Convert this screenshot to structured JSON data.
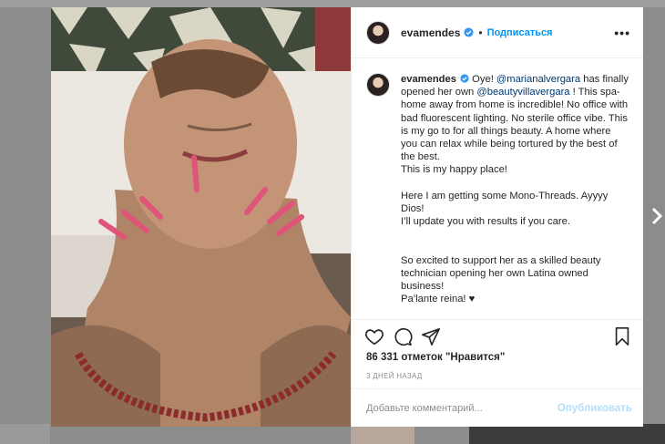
{
  "post": {
    "username": "evamendes",
    "follow_label": "Подписаться",
    "separator": "•",
    "more_label": "•••",
    "caption_user": "evamendes",
    "caption_parts": [
      {
        "text": "Oye! ",
        "type": "text"
      },
      {
        "text": "@marianalvergara",
        "type": "link"
      },
      {
        "text": " has finally opened her own ",
        "type": "text"
      },
      {
        "text": "@beautyvillavergara",
        "type": "link"
      },
      {
        "text": " ! This spa-home away from home is incredible! No office with bad fluorescent lighting. No sterile office vibe. This is my go to for all things beauty. A home where you can relax while being tortured by the best of the best.\nThis is my happy place!\n\nHere I am getting some Mono-Threads. Ayyyy Dios!\nI’ll update you with results if you care.\n\n\nSo excited to support her as a skilled beauty technician opening her own Latina owned business!\nPa’lante reina! ♥",
        "type": "text"
      }
    ],
    "likes": "86 331 отметок \"Нравится\"",
    "date": "3 ДНЕЙ НАЗАД",
    "comment_placeholder": "Добавьте комментарий...",
    "publish_label": "Опубликовать"
  },
  "icons": {
    "like": "heart-icon",
    "comment": "comment-icon",
    "share": "share-icon",
    "save": "bookmark-icon",
    "verified": "verified-badge-icon",
    "next": "chevron-right-icon"
  },
  "colors": {
    "accent": "#0095f6",
    "link": "#00376b",
    "publish_disabled": "#b2dffc"
  }
}
